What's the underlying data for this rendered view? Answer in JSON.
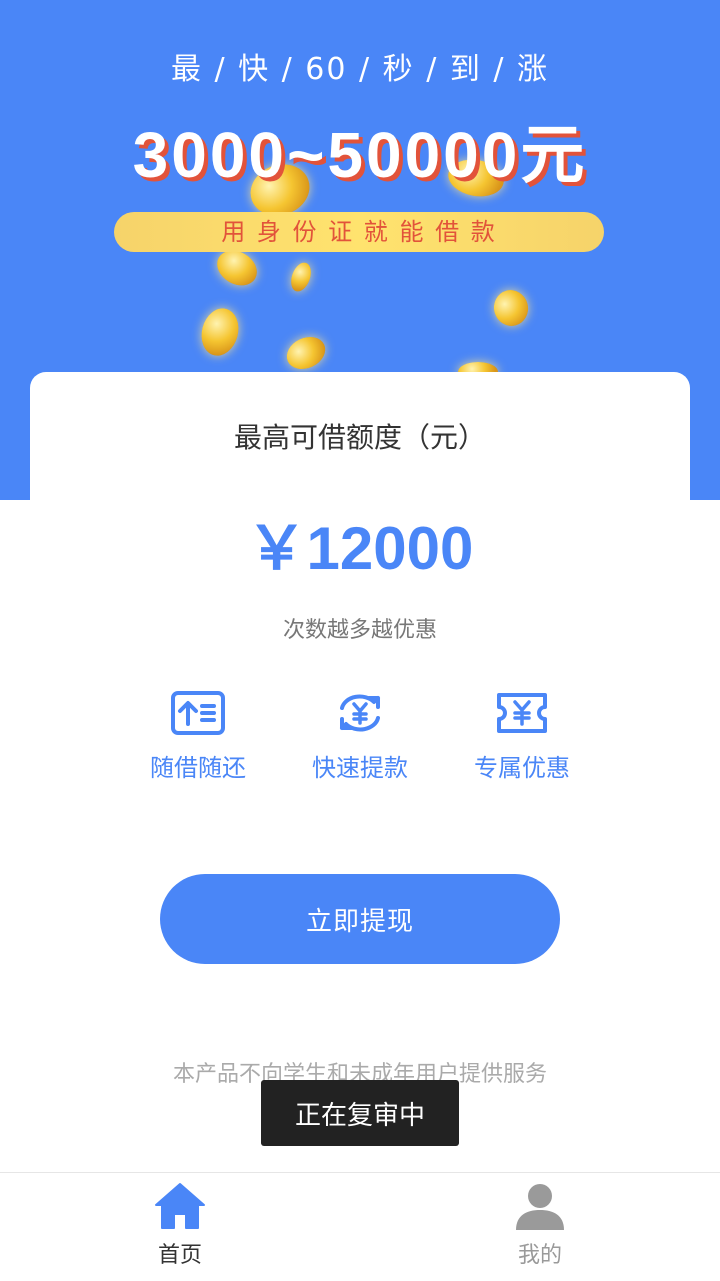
{
  "hero": {
    "tagline": "最 / 快 / 60 / 秒 / 到 / 涨",
    "amount_range": "3000~50000元",
    "ribbon": "用 身 份 证 就 能 借 款"
  },
  "card": {
    "title": "最高可借额度（元）",
    "amount": "￥12000",
    "note": "次数越多越优惠",
    "features": [
      {
        "label": "随借随还",
        "icon": "upload-list-icon"
      },
      {
        "label": "快速提款",
        "icon": "exchange-yen-icon"
      },
      {
        "label": "专属优惠",
        "icon": "coupon-yen-icon"
      }
    ]
  },
  "cta_label": "立即提现",
  "disclaimer": "本产品不向学生和未成年用户提供服务",
  "toast": "正在复审中",
  "tabbar": {
    "items": [
      {
        "label": "首页",
        "icon": "home-icon",
        "active": true
      },
      {
        "label": "我的",
        "icon": "person-icon",
        "active": false
      }
    ]
  },
  "colors": {
    "primary": "#4a86f7",
    "accent_red": "#e2533a",
    "ribbon_yellow": "#ffe36e",
    "tab_active_text": "#333333",
    "tab_inactive": "#9a9a9a"
  }
}
